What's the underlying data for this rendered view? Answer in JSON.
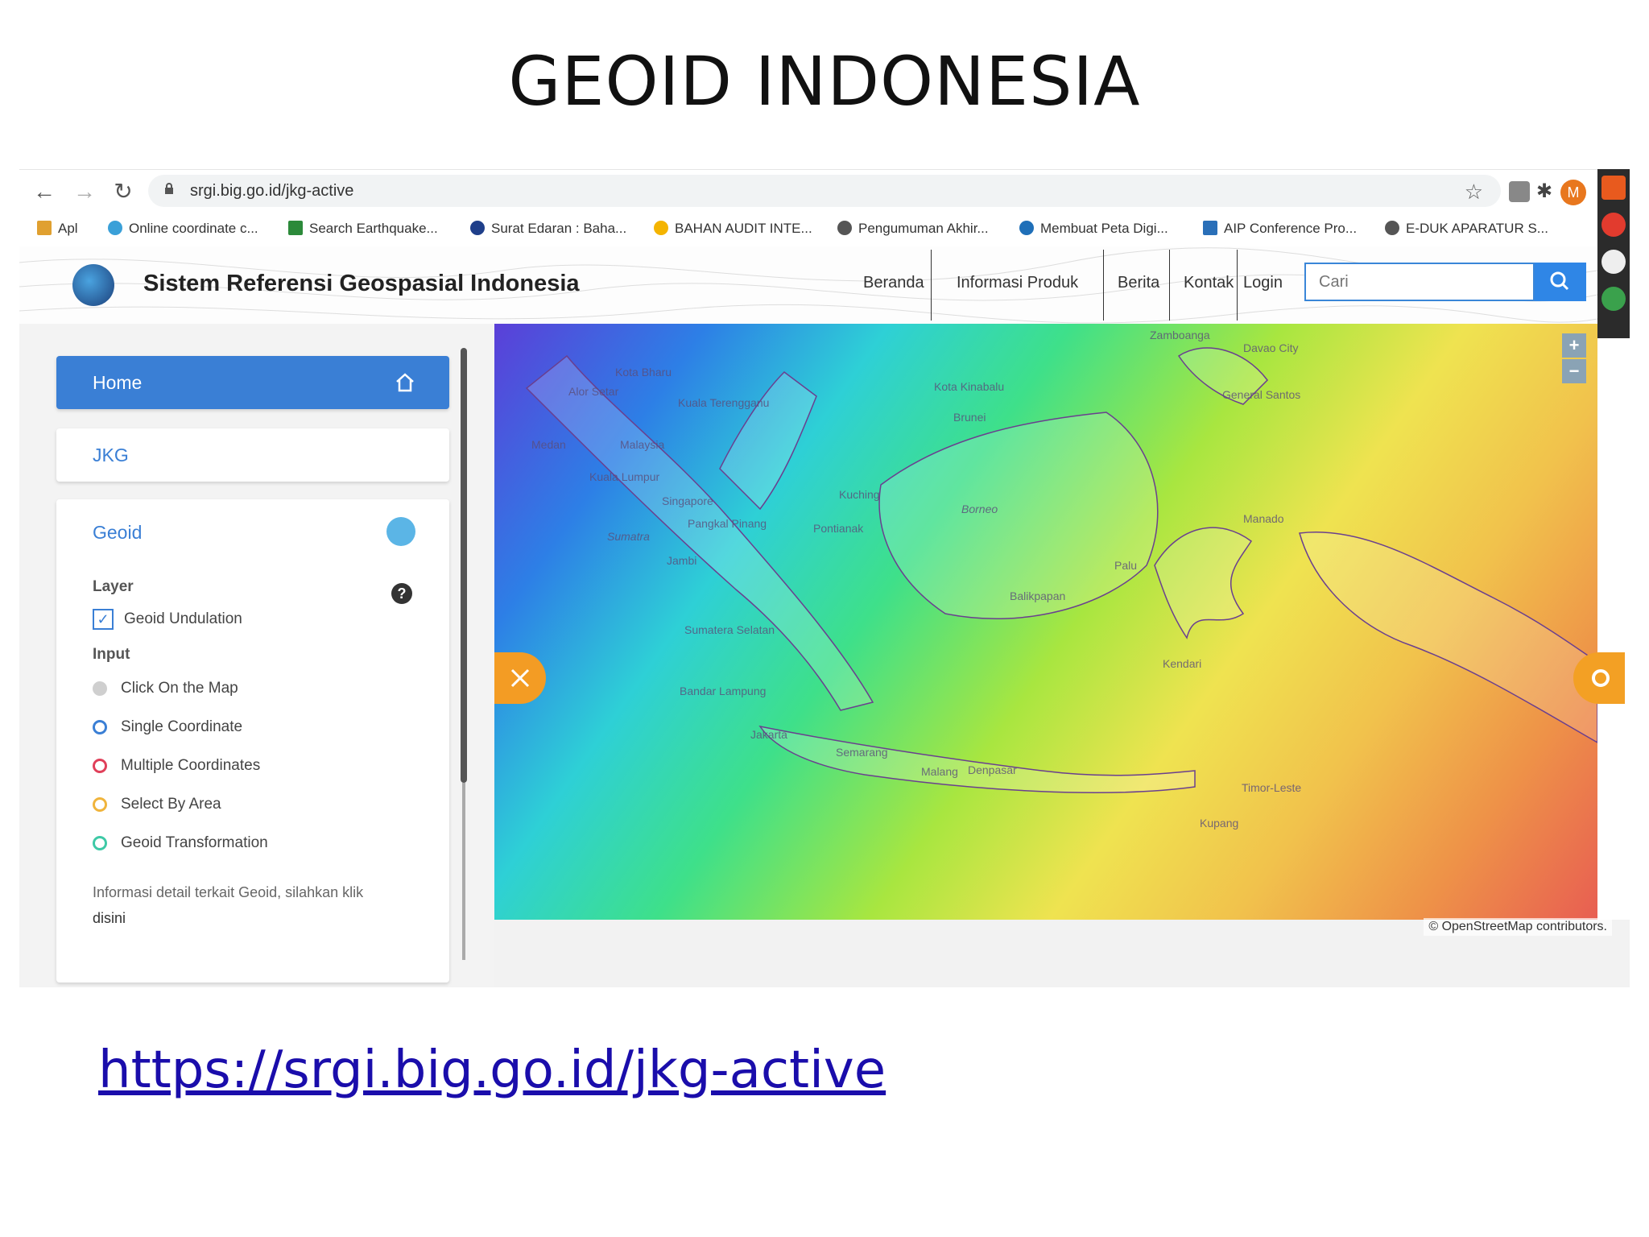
{
  "slide": {
    "title": "GEOID INDONESIA",
    "link": "https://srgi.big.go.id/jkg-active"
  },
  "browser": {
    "url": "srgi.big.go.id/jkg-active",
    "avatar_letter": "M",
    "bookmarks": [
      "Apl",
      "Online coordinate c...",
      "Search Earthquake...",
      "Surat Edaran : Baha...",
      "BAHAN AUDIT INTE...",
      "Pengumuman Akhir...",
      "Membuat Peta Digi...",
      "AIP Conference Pro...",
      "E-DUK APARATUR S..."
    ]
  },
  "site": {
    "title": "Sistem Referensi Geospasial Indonesia",
    "nav": [
      "Beranda",
      "Informasi Produk",
      "Berita",
      "Kontak",
      "Login"
    ],
    "search_placeholder": "Cari"
  },
  "panel": {
    "home_label": "Home",
    "jkg_label": "JKG",
    "geoid_label": "Geoid",
    "layer_heading": "Layer",
    "layer_checkbox": "Geoid Undulation",
    "input_heading": "Input",
    "options": [
      {
        "label": "Click On the Map",
        "color": "#cfcfcf"
      },
      {
        "label": "Single Coordinate",
        "color": "#3a7fd5"
      },
      {
        "label": "Multiple Coordinates",
        "color": "#e0405a"
      },
      {
        "label": "Select By Area",
        "color": "#f0b43c"
      },
      {
        "label": "Geoid Transformation",
        "color": "#3ec9a6"
      }
    ],
    "info_text": "Informasi detail terkait Geoid, silahkan klik",
    "info_link": "disini"
  },
  "map": {
    "attribution": "© OpenStreetMap contributors.",
    "labels": [
      "Kota Bharu",
      "Alor Setar",
      "Kuala Terengganu",
      "Medan",
      "Malaysia",
      "Kuala Lumpur",
      "Singapore",
      "Sumatra",
      "Pangkal Pinang",
      "Jambi",
      "Kota Kinabalu",
      "Brunei",
      "Kuching",
      "Borneo",
      "Pontianak",
      "Balikpapan",
      "Manado",
      "Palu",
      "Kendari",
      "Sumatera Selatan",
      "Bandar Lampung",
      "Jakarta",
      "Semarang",
      "Malang",
      "Denpasar",
      "Kupang",
      "Timor-Leste",
      "Davao City",
      "General Santos",
      "Zamboanga"
    ]
  }
}
